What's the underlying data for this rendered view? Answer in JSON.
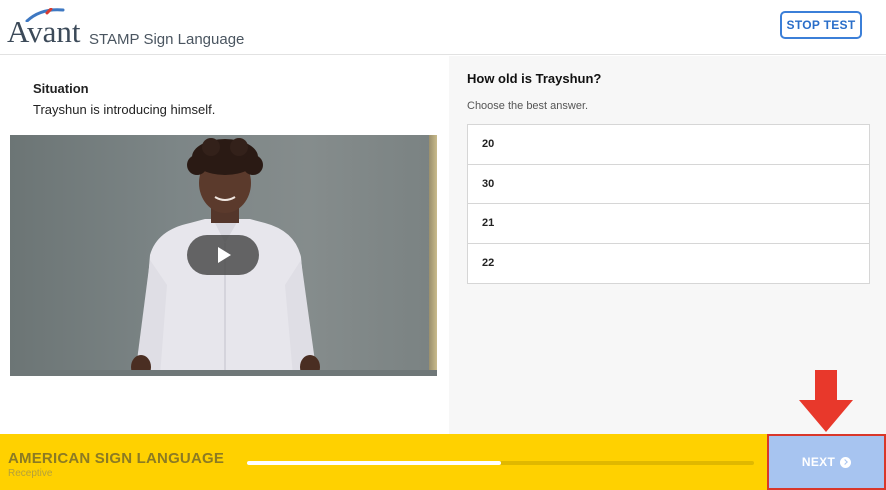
{
  "header": {
    "logo_text": "Avant",
    "app_name": "STAMP Sign Language",
    "stop_button": "STOP TEST"
  },
  "situation": {
    "title": "Situation",
    "text": "Trayshun is introducing himself."
  },
  "video": {
    "play_icon": "play-icon"
  },
  "question": {
    "prompt": "How old is Trayshun?",
    "instruction": "Choose the best answer.",
    "options": [
      "20",
      "30",
      "21",
      "22"
    ]
  },
  "footer": {
    "course_title": "AMERICAN SIGN LANGUAGE",
    "course_subtitle": "Receptive",
    "progress": 0.5,
    "next_button": "NEXT",
    "next_icon": "chevron-circle-right-icon"
  },
  "colors": {
    "accent_blue": "#3b7fd8",
    "footer_yellow": "#ffd100",
    "next_bg": "#a7c4f0",
    "highlight_red": "#d9372a"
  }
}
